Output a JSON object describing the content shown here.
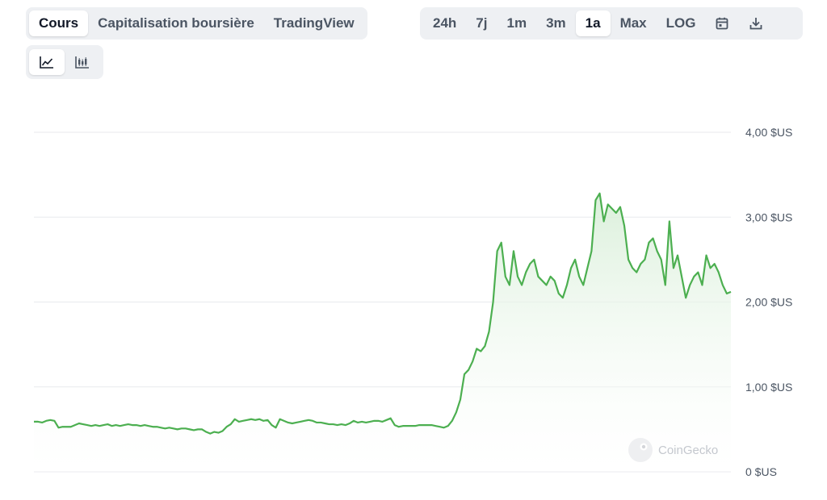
{
  "tabs": {
    "main": [
      {
        "label": "Cours",
        "active": true
      },
      {
        "label": "Capitalisation boursière",
        "active": false
      },
      {
        "label": "TradingView",
        "active": false
      }
    ],
    "ranges": [
      {
        "label": "24h",
        "active": false
      },
      {
        "label": "7j",
        "active": false
      },
      {
        "label": "1m",
        "active": false
      },
      {
        "label": "3m",
        "active": false
      },
      {
        "label": "1a",
        "active": true
      },
      {
        "label": "Max",
        "active": false
      },
      {
        "label": "LOG",
        "active": false
      }
    ],
    "range_icons": [
      "calendar-icon",
      "download-icon"
    ],
    "chart_types": [
      {
        "icon": "line-chart-icon",
        "active": true
      },
      {
        "icon": "candlestick-chart-icon",
        "active": false
      }
    ]
  },
  "watermark": "CoinGecko",
  "colors": {
    "line": "#4caf50",
    "fill_top": "#d9efd9",
    "grid": "#e8eaed",
    "accent": "#4caf50"
  },
  "chart_data": {
    "type": "area",
    "title": "",
    "xlabel": "",
    "ylabel": "",
    "ylim": [
      0,
      4
    ],
    "yticks": [
      0,
      1,
      2,
      3,
      4
    ],
    "ytick_labels": [
      "0 $US",
      "1,00 $US",
      "2,00 $US",
      "3,00 $US",
      "4,00 $US"
    ],
    "grid": true,
    "series": [
      {
        "values": [
          0.59,
          0.59,
          0.58,
          0.6,
          0.61,
          0.6,
          0.52,
          0.53,
          0.53,
          0.53,
          0.55,
          0.57,
          0.56,
          0.55,
          0.54,
          0.55,
          0.54,
          0.55,
          0.56,
          0.54,
          0.55,
          0.54,
          0.55,
          0.56,
          0.55,
          0.55,
          0.54,
          0.55,
          0.54,
          0.53,
          0.53,
          0.52,
          0.51,
          0.52,
          0.51,
          0.5,
          0.51,
          0.51,
          0.5,
          0.49,
          0.5,
          0.5,
          0.47,
          0.45,
          0.47,
          0.46,
          0.48,
          0.53,
          0.56,
          0.62,
          0.59,
          0.6,
          0.61,
          0.62,
          0.61,
          0.62,
          0.6,
          0.61,
          0.55,
          0.52,
          0.62,
          0.6,
          0.58,
          0.57,
          0.58,
          0.59,
          0.6,
          0.61,
          0.6,
          0.58,
          0.58,
          0.57,
          0.56,
          0.56,
          0.55,
          0.56,
          0.55,
          0.57,
          0.6,
          0.58,
          0.59,
          0.58,
          0.59,
          0.6,
          0.6,
          0.59,
          0.61,
          0.63,
          0.55,
          0.53,
          0.54,
          0.54,
          0.54,
          0.54,
          0.55,
          0.55,
          0.55,
          0.55,
          0.54,
          0.53,
          0.52,
          0.54,
          0.6,
          0.7,
          0.85,
          1.15,
          1.2,
          1.3,
          1.45,
          1.42,
          1.48,
          1.65,
          2.0,
          2.6,
          2.7,
          2.3,
          2.2,
          2.6,
          2.3,
          2.2,
          2.35,
          2.45,
          2.5,
          2.3,
          2.25,
          2.2,
          2.3,
          2.25,
          2.1,
          2.05,
          2.2,
          2.4,
          2.5,
          2.3,
          2.2,
          2.4,
          2.6,
          3.2,
          3.28,
          2.95,
          3.15,
          3.1,
          3.05,
          3.12,
          2.9,
          2.5,
          2.4,
          2.35,
          2.45,
          2.5,
          2.7,
          2.75,
          2.6,
          2.5,
          2.2,
          2.95,
          2.4,
          2.55,
          2.3,
          2.05,
          2.2,
          2.3,
          2.35,
          2.2,
          2.55,
          2.4,
          2.45,
          2.35,
          2.2,
          2.1,
          2.12
        ]
      }
    ]
  }
}
